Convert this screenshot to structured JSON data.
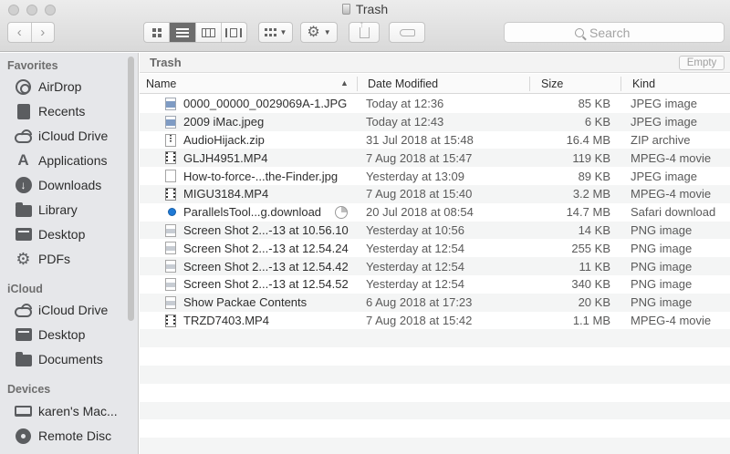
{
  "window": {
    "title": "Trash"
  },
  "toolbar": {
    "back_icon": "chevron-left-icon",
    "forward_icon": "chevron-right-icon",
    "views": [
      "icon-view",
      "list-view",
      "column-view",
      "cover-flow-view"
    ],
    "active_view": "list-view",
    "search_placeholder": "Search"
  },
  "sidebar": {
    "favorites": {
      "title": "Favorites",
      "items": [
        {
          "label": "AirDrop",
          "icon": "airdrop-icon"
        },
        {
          "label": "Recents",
          "icon": "recents-icon"
        },
        {
          "label": "iCloud Drive",
          "icon": "cloud-icon"
        },
        {
          "label": "Applications",
          "icon": "applications-icon"
        },
        {
          "label": "Downloads",
          "icon": "downloads-icon"
        },
        {
          "label": "Library",
          "icon": "folder-icon"
        },
        {
          "label": "Desktop",
          "icon": "desktop-icon"
        },
        {
          "label": "PDFs",
          "icon": "gear-icon"
        }
      ]
    },
    "icloud": {
      "title": "iCloud",
      "items": [
        {
          "label": "iCloud Drive",
          "icon": "cloud-icon"
        },
        {
          "label": "Desktop",
          "icon": "desktop-icon"
        },
        {
          "label": "Documents",
          "icon": "documents-icon"
        }
      ]
    },
    "devices": {
      "title": "Devices",
      "items": [
        {
          "label": "karen's Mac...",
          "icon": "laptop-icon"
        },
        {
          "label": "Remote Disc",
          "icon": "disc-icon"
        }
      ]
    }
  },
  "main": {
    "path_title": "Trash",
    "empty_label": "Empty",
    "columns": {
      "name": "Name",
      "date": "Date Modified",
      "size": "Size",
      "kind": "Kind"
    },
    "files": [
      {
        "name": "0000_00000_0029069A-1.JPG",
        "date": "Today at 12:36",
        "size": "85 KB",
        "kind": "JPEG image",
        "icon": "image-file-icon"
      },
      {
        "name": "2009 iMac.jpeg",
        "date": "Today at 12:43",
        "size": "6 KB",
        "kind": "JPEG image",
        "icon": "image-file-icon"
      },
      {
        "name": "AudioHijack.zip",
        "date": "31 Jul 2018 at 15:48",
        "size": "16.4 MB",
        "kind": "ZIP archive",
        "icon": "zip-file-icon"
      },
      {
        "name": "GLJH4951.MP4",
        "date": "7 Aug 2018 at 15:47",
        "size": "119 KB",
        "kind": "MPEG-4 movie",
        "icon": "movie-file-icon"
      },
      {
        "name": "How-to-force-...the-Finder.jpg",
        "date": "Yesterday at 13:09",
        "size": "89 KB",
        "kind": "JPEG image",
        "icon": "document-file-icon"
      },
      {
        "name": "MIGU3184.MP4",
        "date": "7 Aug 2018 at 15:40",
        "size": "3.2 MB",
        "kind": "MPEG-4 movie",
        "icon": "movie-file-icon"
      },
      {
        "name": "ParallelsTool...g.download",
        "date": "20 Jul 2018 at 08:54",
        "size": "14.7 MB",
        "kind": "Safari download",
        "icon": "safari-download-icon"
      },
      {
        "name": "Screen Shot 2...-13 at 10.56.10",
        "date": "Yesterday at 10:56",
        "size": "14 KB",
        "kind": "PNG image",
        "icon": "png-file-icon"
      },
      {
        "name": "Screen Shot 2...-13 at 12.54.24",
        "date": "Yesterday at 12:54",
        "size": "255 KB",
        "kind": "PNG image",
        "icon": "png-file-icon"
      },
      {
        "name": "Screen Shot 2...-13 at 12.54.42",
        "date": "Yesterday at 12:54",
        "size": "11 KB",
        "kind": "PNG image",
        "icon": "png-file-icon"
      },
      {
        "name": "Screen Shot 2...-13 at 12.54.52",
        "date": "Yesterday at 12:54",
        "size": "340 KB",
        "kind": "PNG image",
        "icon": "png-file-icon"
      },
      {
        "name": "Show Packae Contents",
        "date": "6 Aug 2018 at 17:23",
        "size": "20 KB",
        "kind": "PNG image",
        "icon": "png-file-icon"
      },
      {
        "name": "TRZD7403.MP4",
        "date": "7 Aug 2018 at 15:42",
        "size": "1.1 MB",
        "kind": "MPEG-4 movie",
        "icon": "movie-file-icon"
      }
    ],
    "empty_rows": 7
  }
}
